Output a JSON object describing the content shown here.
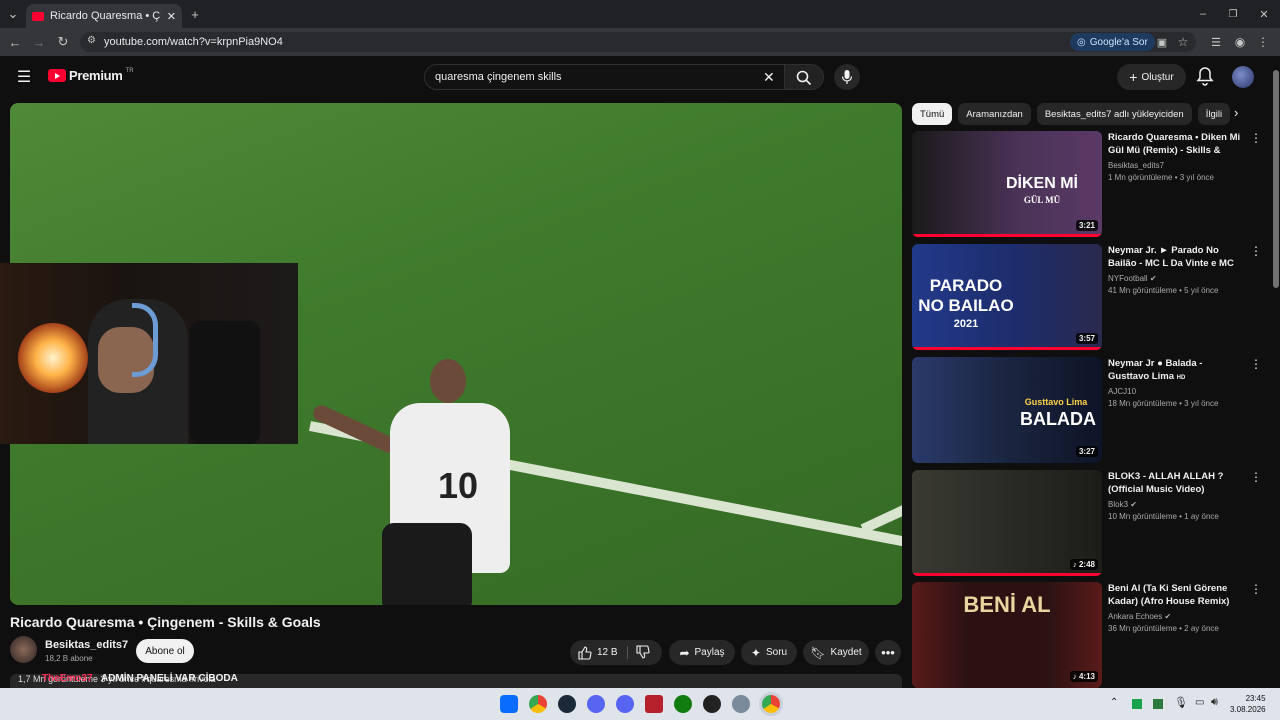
{
  "browser": {
    "tab_title": "Ricardo Quaresma • Çingenem",
    "url": "youtube.com/watch?v=krpnPia9NO4",
    "google_sor": "Google'a Sor"
  },
  "header": {
    "logo_word": "Premium",
    "logo_country": "TR",
    "search_value": "quaresma çingenem skills",
    "create_label": "Oluştur"
  },
  "video": {
    "jersey_number": "10",
    "title": "Ricardo Quaresma • Çingenem - Skills & Goals",
    "channel": "Besiktas_edits7",
    "subscribers": "18,2 B abone",
    "subscribe_label": "Abone ol",
    "likes": "12 B",
    "share_label": "Paylaş",
    "ask_label": "Soru",
    "save_label": "Kaydet",
    "description_partial": "1,7 Mn görüntüleme  3 yıl önce  #quaresma #rivola",
    "chat_user": "TheEmo37",
    "chat_message": "ADMİN PANELİ VAR CİBODA"
  },
  "chips": [
    {
      "label": "Tümü",
      "active": true
    },
    {
      "label": "Aramanızdan",
      "active": false
    },
    {
      "label": "Besiktas_edits7 adlı yükleyiciden",
      "active": false
    },
    {
      "label": "İlgili",
      "active": false
    }
  ],
  "recommendations": [
    {
      "title": "Ricardo Quaresma • Diken Mi Gül Mü (Remix) - Skills & Goals",
      "channel": "Besiktas_edits7",
      "views": "1 Mn görüntüleme • 3 yıl önce",
      "duration": "3:21",
      "thumb_text": "DİKEN Mİ",
      "thumb_sub": "GÜL MÜ",
      "thumb_color": "#3a2a4a"
    },
    {
      "title": "Neymar Jr. ► Parado No Bailão - MC L Da Vinte e MC Gury • ...",
      "channel": "NYFootball",
      "views": "41 Mn görüntüleme • 5 yıl önce",
      "duration": "3:57",
      "thumb_text": "PARADO NO BAILAO",
      "thumb_sub": "2021",
      "thumb_color": "#1d2c6b"
    },
    {
      "title": "Neymar Jr ● Balada - Gusttavo Lima",
      "channel": "AJCJ10",
      "views": "18 Mn görüntüleme • 3 yıl önce",
      "duration": "3:27",
      "thumb_text": "BALADA",
      "thumb_sub": "Gusttavo Lima",
      "thumb_color": "#1a2540"
    },
    {
      "title": "BLOK3 - ALLAH ALLAH ? (Official Music Video)",
      "channel": "Blok3",
      "views": "10 Mn görüntüleme • 1 ay önce",
      "duration": "2:48",
      "thumb_text": "",
      "thumb_sub": "",
      "thumb_color": "#2b2b26"
    },
    {
      "title": "Beni Al (Ta Ki Seni Görene Kadar) (Afro House Remix)",
      "channel": "Ankara Echoes",
      "views": "36 Mn görüntüleme • 2 ay önce",
      "duration": "4:13",
      "thumb_text": "BENİ AL",
      "thumb_sub": "",
      "thumb_color": "#3b1414"
    }
  ],
  "taskbar": {
    "time": "23:45",
    "date": "3.08.2026"
  },
  "colors": {
    "accent": "#ff0033",
    "background": "#0f0f0f",
    "surface": "#272727"
  }
}
